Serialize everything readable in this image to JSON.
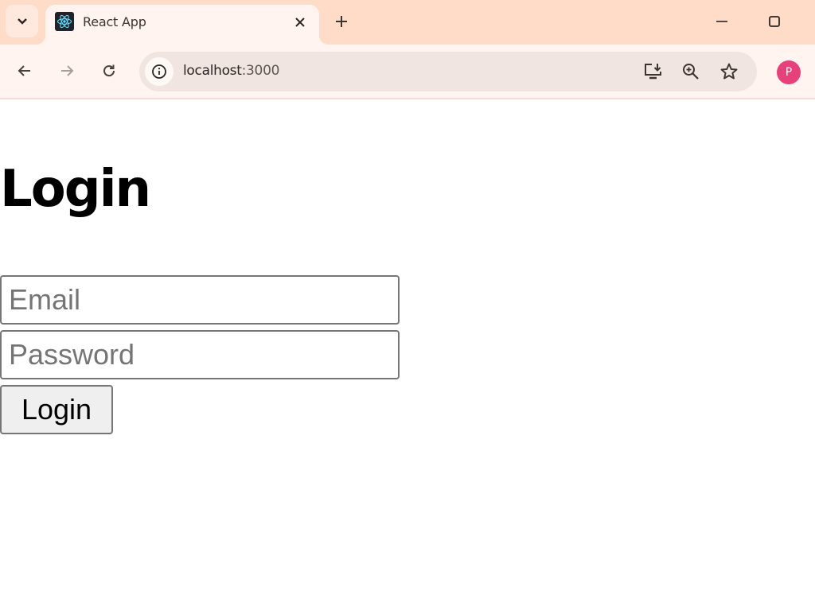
{
  "browser": {
    "tabs": [
      {
        "title": "React App",
        "favicon": "react-logo-icon",
        "active": true
      }
    ],
    "tab_search_icon": "chevron-down-icon",
    "new_tab_icon": "plus-icon",
    "window_controls": [
      "minimize-icon",
      "maximize-icon"
    ],
    "toolbar": {
      "back_icon": "arrow-left-icon",
      "forward_icon": "arrow-right-icon",
      "reload_icon": "reload-icon",
      "site_info_icon": "info-icon",
      "url_host": "localhost",
      "url_port": ":3000",
      "omnibox_icons": [
        "install-app-icon",
        "zoom-icon",
        "bookmark-star-icon"
      ],
      "profile_initial": "P",
      "profile_color": "#e8407a"
    }
  },
  "page": {
    "title": "Login",
    "form": {
      "email_placeholder": "Email",
      "email_value": "",
      "password_placeholder": "Password",
      "password_value": "",
      "submit_label": "Login"
    }
  },
  "colors": {
    "tabstrip_bg": "#ffdcc8",
    "toolbar_bg": "#fff4f0",
    "omnibox_bg": "#f1e5e2"
  }
}
